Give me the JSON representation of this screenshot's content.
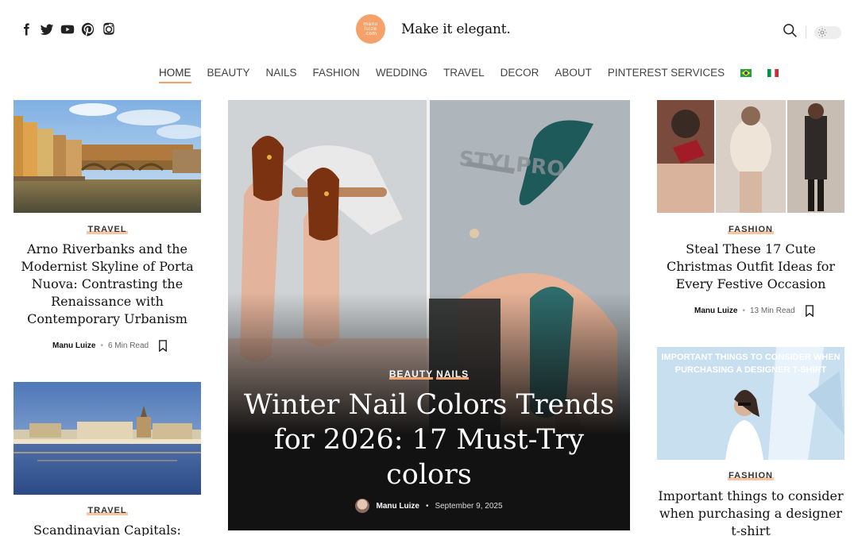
{
  "header": {
    "tagline": "Make it elegant.",
    "logo_lines": [
      "manu",
      "luize",
      ".com"
    ],
    "social_icons": [
      "facebook-icon",
      "twitter-icon",
      "youtube-icon",
      "pinterest-icon",
      "instagram-icon"
    ]
  },
  "nav": {
    "items": [
      "HOME",
      "BEAUTY",
      "NAILS",
      "FASHION",
      "WEDDING",
      "TRAVEL",
      "DECOR",
      "ABOUT",
      "PINTEREST SERVICES"
    ],
    "active": "HOME",
    "flags": [
      "brazil-flag-icon",
      "italy-flag-icon"
    ]
  },
  "left_cards": [
    {
      "category": "TRAVEL",
      "title": "Arno Riverbanks and the Modernist Skyline of Porta Nuova: Contrasting the Renaissance with Contemporary Urbanism",
      "author": "Manu Luize",
      "read_time": "6 Min Read"
    },
    {
      "category": "TRAVEL",
      "title": "Scandinavian Capitals:"
    }
  ],
  "feature": {
    "categories": [
      "BEAUTY",
      "NAILS"
    ],
    "title": "Winter Nail Colors Trends for 2026: 17 Must-Try colors",
    "author": "Manu Luize",
    "date": "September 9, 2025",
    "image_text": "STYLPRO"
  },
  "right_cards": [
    {
      "category": "FASHION",
      "title": "Steal These 17 Cute Christmas Outfit Ideas for Every Festive Occasion",
      "author": "Manu Luize",
      "read_time": "13 Min Read"
    },
    {
      "category": "FASHION",
      "title": "Important things to consider when purchasing a designer t-shirt",
      "image_caption": "IMPORTANT THINGS TO CONSIDER WHEN PURCHASING A DESIGNER T-SHIRT"
    }
  ],
  "colors": {
    "accent": "#f5a26a",
    "text": "#111111",
    "feature_bg": "#151515"
  }
}
